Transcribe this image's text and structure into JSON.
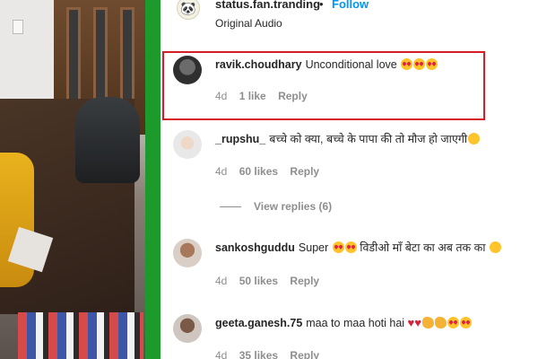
{
  "header": {
    "account_name": "status.fan.tranding",
    "separator": "•",
    "follow_label": "Follow",
    "audio_label": "Original Audio"
  },
  "comments": [
    {
      "username": "ravik.choudhary",
      "text": "Unconditional love",
      "emojis": [
        "star-struck-emoji",
        "smiling-hearts-emoji",
        "smiling-hearts-emoji"
      ],
      "time": "4d",
      "likes": "1 like",
      "reply_label": "Reply",
      "highlighted": true
    },
    {
      "username": "_rupshu_",
      "text": "बच्चे को क्या, बच्चे के पापा की तो मौज हो जाएगी",
      "emojis": [
        "laughing-tears-emoji"
      ],
      "time": "4d",
      "likes": "60 likes",
      "reply_label": "Reply"
    },
    {
      "username": "sankoshguddu",
      "text": "Super",
      "text_after": "विडीओ माँ बेटा का अब तक का",
      "emojis": [
        "smiling-hearts-emoji",
        "smiling-hearts-emoji"
      ],
      "emojis_after": [
        "pleading-emoji"
      ],
      "time": "4d",
      "likes": "50 likes",
      "reply_label": "Reply"
    },
    {
      "username": "geeta.ganesh.75",
      "text": "maa to maa hoti hai",
      "emojis": [
        "red-heart-emoji",
        "red-heart-emoji",
        "clapping-hands-emoji",
        "clapping-hands-emoji",
        "star-struck-emoji",
        "star-struck-emoji"
      ],
      "time": "4d",
      "likes": "35 likes",
      "reply_label": "Reply"
    }
  ],
  "view_replies_label": "View replies (6)",
  "colors": {
    "divider_green": "#1c9a2c",
    "highlight_red": "#d81e25",
    "follow_blue": "#0095f6",
    "meta_gray": "#8e8e8e"
  }
}
